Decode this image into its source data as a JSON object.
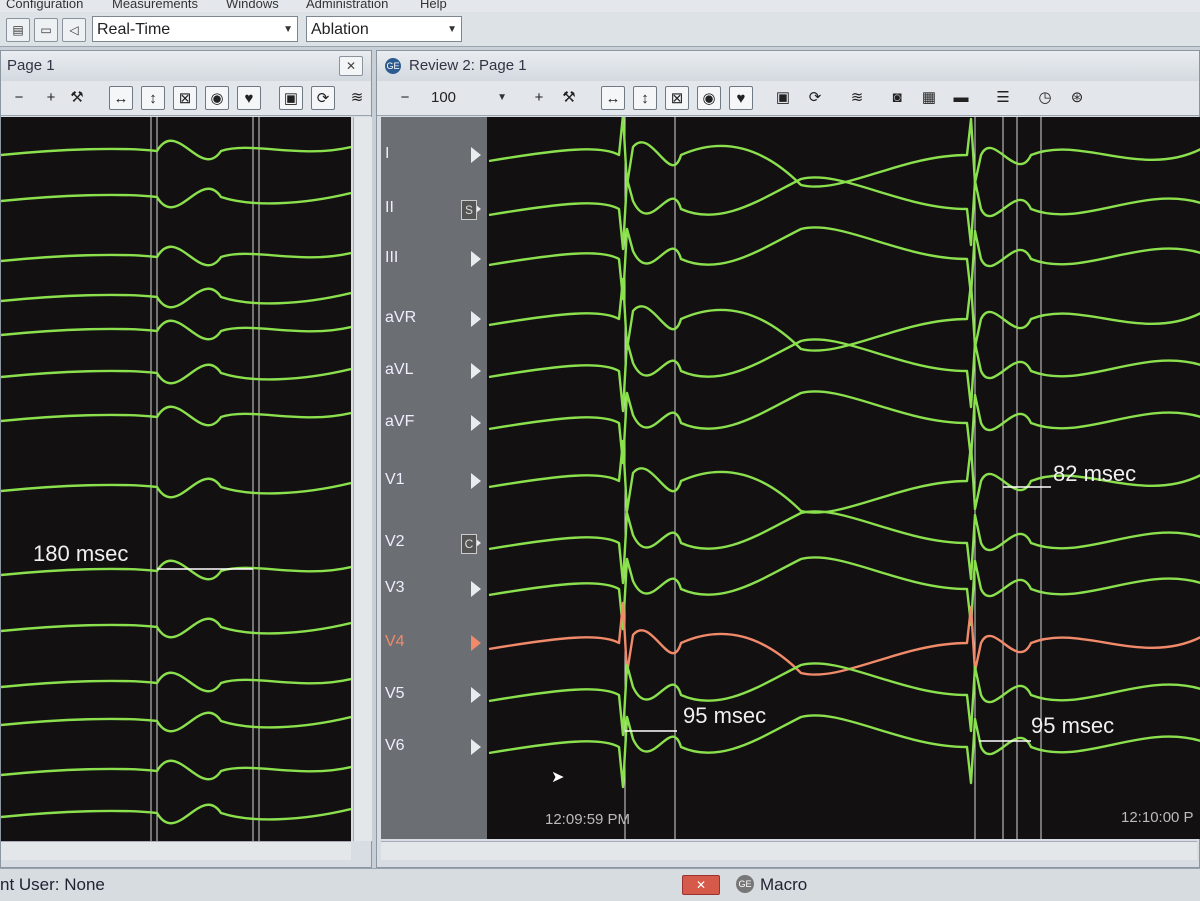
{
  "menu": {
    "items": [
      "Configuration",
      "Measurements",
      "Windows",
      "Administration",
      "Help"
    ]
  },
  "topbar": {
    "mode_select": "Real-Time",
    "procedure_select": "Ablation"
  },
  "left_window": {
    "title": "Page 1",
    "close_label": "✕",
    "measurement": "180 msec"
  },
  "right_window": {
    "title": "Review 2: Page 1",
    "zoom_value": "100",
    "leads": [
      "I",
      "II",
      "III",
      "aVR",
      "aVL",
      "aVF",
      "V1",
      "V2",
      "V3",
      "V4",
      "V5",
      "V6"
    ],
    "highlighted_lead": "V4",
    "lead_tags": {
      "II": "S",
      "V2": "C"
    },
    "measurements": [
      "95 msec",
      "95 msec",
      "82 msec"
    ],
    "timestamps": [
      "12:09:59 PM",
      "12:10:00 P"
    ]
  },
  "statusbar": {
    "user_text": "nt User: None",
    "close_label": "✕",
    "macro_label": "Macro"
  },
  "colors": {
    "trace": "#8be04e",
    "highlight_trace": "#f08a6a",
    "background": "#121010"
  }
}
